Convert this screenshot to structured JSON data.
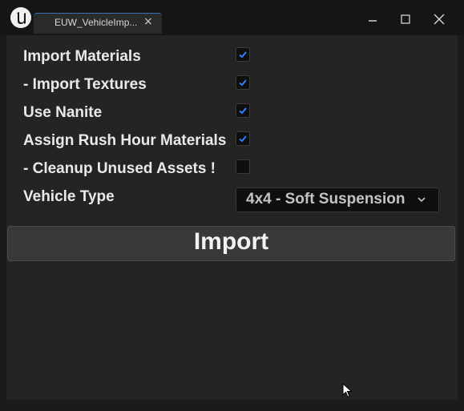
{
  "window": {
    "tab_title": "EUW_VehicleImp...",
    "tab_close": "×"
  },
  "options": [
    {
      "label": "Import Materials",
      "checked": true
    },
    {
      "label": "- Import Textures",
      "checked": true
    },
    {
      "label": "Use Nanite",
      "checked": true
    },
    {
      "label": "Assign Rush Hour Materials",
      "checked": true
    },
    {
      "label": "- Cleanup Unused Assets !",
      "checked": false
    }
  ],
  "vehicle_type": {
    "label": "Vehicle Type",
    "selected": "4x4 - Soft Suspension"
  },
  "import_button": {
    "label": "Import"
  },
  "colors": {
    "check_accent": "#2f80ff",
    "tab_accent": "#3b6fb6"
  }
}
